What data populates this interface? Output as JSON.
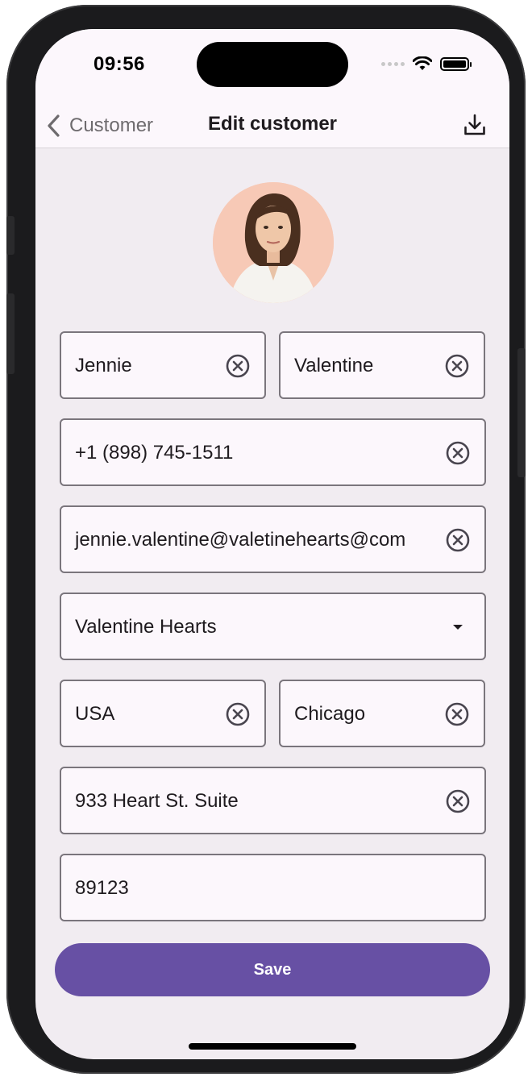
{
  "status_bar": {
    "time": "09:56"
  },
  "nav": {
    "back_label": "Customer",
    "title": "Edit customer"
  },
  "form": {
    "first_name": "Jennie",
    "last_name": "Valentine",
    "phone": "+1 (898) 745-1511",
    "email": "jennie.valentine@valetinehearts@com",
    "company": "Valentine Hearts",
    "country": "USA",
    "city": "Chicago",
    "address": "933 Heart St. Suite",
    "zip": "89123"
  },
  "actions": {
    "save_label": "Save"
  },
  "colors": {
    "accent": "#6750a4",
    "background": "#f1ecf1",
    "surface": "#fcf7fc",
    "avatar_bg": "#f7c9b6"
  },
  "icons": [
    "chevron-left-icon",
    "download-icon",
    "clear-circle-icon",
    "dropdown-caret-icon",
    "wifi-icon",
    "battery-icon",
    "signal-icon"
  ]
}
